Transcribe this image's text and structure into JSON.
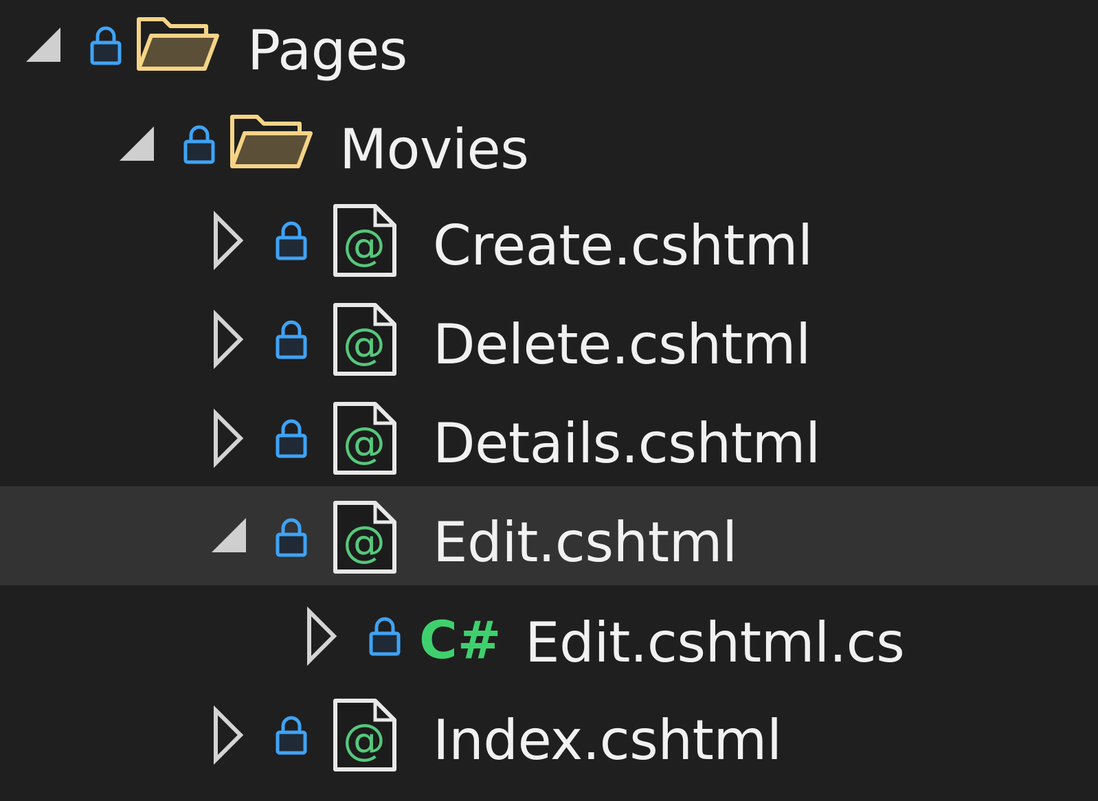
{
  "colors": {
    "background": "#1f1f1f",
    "selected_row": "#333333",
    "lock_blue": "#3fa3f5",
    "folder_outline": "#f5d487",
    "folder_fill": "#5b4f37",
    "razor_green": "#57c77c",
    "csharp_green": "#3fd06e",
    "file_outline": "#e8e8e8",
    "text": "#f1f1f1"
  },
  "tree": {
    "items": [
      {
        "label": "Pages",
        "kind": "folder",
        "expander": "expanded-arrow-icon",
        "icon": "folder-icon",
        "locked": true,
        "depth": 0
      },
      {
        "label": "Movies",
        "kind": "folder",
        "expander": "expanded-arrow-icon",
        "icon": "folder-icon",
        "locked": true,
        "depth": 1
      },
      {
        "label": "Create.cshtml",
        "kind": "razor",
        "expander": "collapsed-arrow-icon",
        "icon": "razor-file-icon",
        "locked": true,
        "depth": 2
      },
      {
        "label": "Delete.cshtml",
        "kind": "razor",
        "expander": "collapsed-arrow-icon",
        "icon": "razor-file-icon",
        "locked": true,
        "depth": 2
      },
      {
        "label": "Details.cshtml",
        "kind": "razor",
        "expander": "collapsed-arrow-icon",
        "icon": "razor-file-icon",
        "locked": true,
        "depth": 2
      },
      {
        "label": "Edit.cshtml",
        "kind": "razor",
        "expander": "expanded-arrow-icon",
        "icon": "razor-file-icon",
        "locked": true,
        "depth": 2,
        "selected": true
      },
      {
        "label": "Edit.cshtml.cs",
        "kind": "csharp",
        "expander": "collapsed-arrow-icon",
        "icon": "csharp-file-icon",
        "icon_text": "C#",
        "locked": true,
        "depth": 3
      },
      {
        "label": "Index.cshtml",
        "kind": "razor",
        "expander": "collapsed-arrow-icon",
        "icon": "razor-file-icon",
        "locked": true,
        "depth": 2
      }
    ]
  }
}
